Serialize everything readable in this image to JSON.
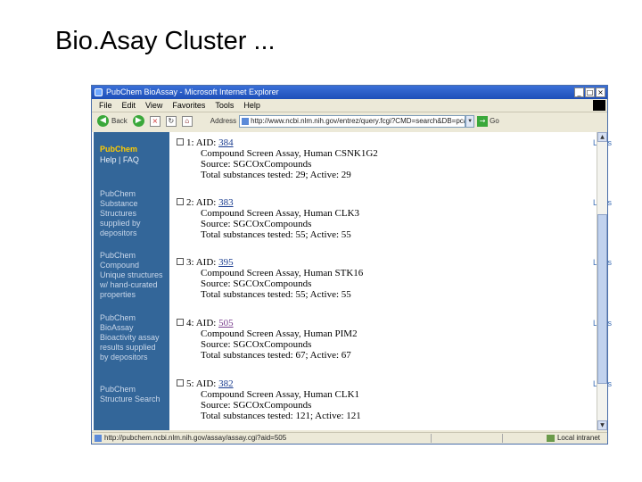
{
  "slide": {
    "title": "Bio.Asay Cluster ..."
  },
  "window": {
    "title": "PubChem BioAssay - Microsoft Internet Explorer",
    "buttons": {
      "minimize": "_",
      "maximize": "□",
      "close": "×"
    }
  },
  "menu": [
    "File",
    "Edit",
    "View",
    "Favorites",
    "Tools",
    "Help"
  ],
  "toolbar": {
    "back_label": "Back",
    "address_label": "Address",
    "address_value": "http://www.ncbi.nlm.nih.gov/entrez/query.fcgi?CMD=search&DB=pcassay",
    "go_label": "Go"
  },
  "sidebar": {
    "brand": "PubChem",
    "brand_sub": "Help | FAQ",
    "items": [
      "PubChem Substance Structures supplied by depositors",
      "PubChem Compound Unique structures w/ hand-curated properties",
      "PubChem BioAssay Bioactivity assay results supplied by depositors",
      "PubChem Structure Search"
    ]
  },
  "results": [
    {
      "index": "1:",
      "aid_label": "AID:",
      "aid": "384",
      "title": "Compound Screen Assay, Human CSNK1G2",
      "source": "Source: SGCOxCompounds",
      "totals": "Total substances tested: 29; Active: 29",
      "links": "Links",
      "visited": false
    },
    {
      "index": "2:",
      "aid_label": "AID:",
      "aid": "383",
      "title": "Compound Screen Assay, Human CLK3",
      "source": "Source: SGCOxCompounds",
      "totals": "Total substances tested: 55; Active: 55",
      "links": "Links",
      "visited": false
    },
    {
      "index": "3:",
      "aid_label": "AID:",
      "aid": "395",
      "title": "Compound Screen Assay, Human STK16",
      "source": "Source: SGCOxCompounds",
      "totals": "Total substances tested: 55; Active: 55",
      "links": "Links",
      "visited": false
    },
    {
      "index": "4:",
      "aid_label": "AID:",
      "aid": "505",
      "title": "Compound Screen Assay, Human PIM2",
      "source": "Source: SGCOxCompounds",
      "totals": "Total substances tested: 67; Active: 67",
      "links": "Links",
      "visited": true
    },
    {
      "index": "5:",
      "aid_label": "AID:",
      "aid": "382",
      "title": "Compound Screen Assay, Human CLK1",
      "source": "Source: SGCOxCompounds",
      "totals": "Total substances tested: 121; Active: 121",
      "links": "Links",
      "visited": false
    }
  ],
  "status": {
    "text": "http://pubchem.ncbi.nlm.nih.gov/assay/assay.cgi?aid=505",
    "zone": "Local intranet"
  },
  "icons": [
    "app-icon",
    "back-icon",
    "forward-icon",
    "stop-icon",
    "refresh-icon",
    "home-icon",
    "page-icon",
    "go-icon",
    "local-intranet-icon"
  ]
}
